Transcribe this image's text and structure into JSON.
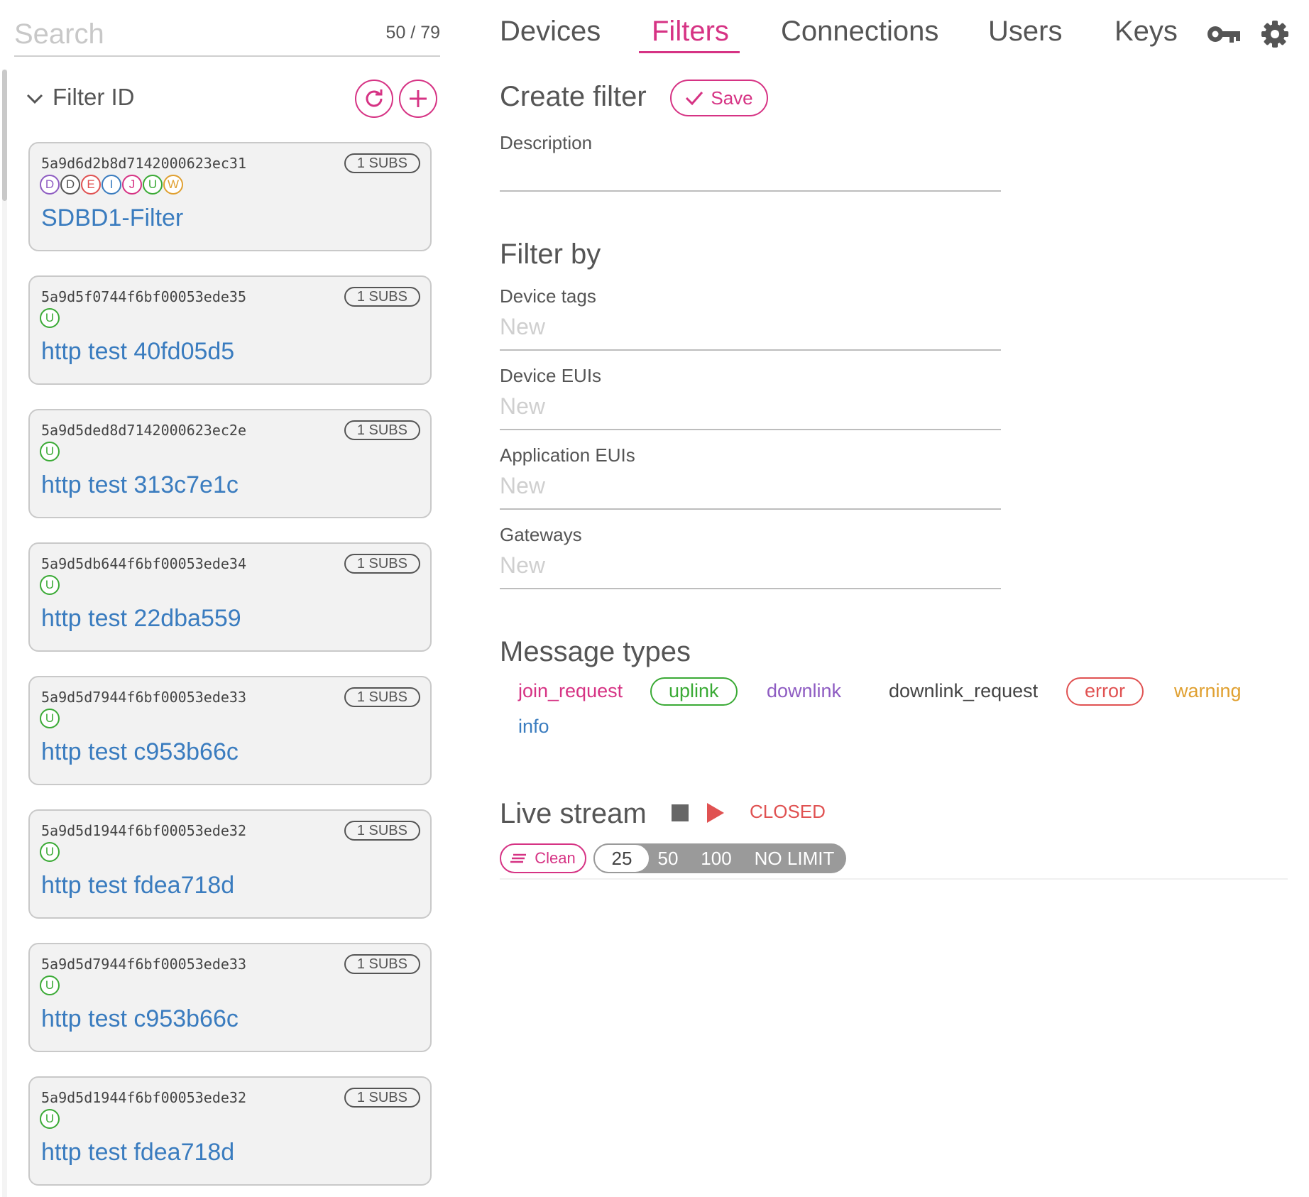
{
  "search": {
    "placeholder": "Search",
    "value": "",
    "count": "50 / 79"
  },
  "sidebar": {
    "header_title": "Filter ID",
    "filters": [
      {
        "id": "5a9d6d2b8d7142000623ec31",
        "subs": "1 SUBS",
        "tags": [
          "D",
          "D",
          "E",
          "I",
          "J",
          "U",
          "W"
        ],
        "name": "SDBD1-Filter"
      },
      {
        "id": "5a9d5f0744f6bf00053ede35",
        "subs": "1 SUBS",
        "tags": [
          "U"
        ],
        "name": "http test 40fd05d5"
      },
      {
        "id": "5a9d5ded8d7142000623ec2e",
        "subs": "1 SUBS",
        "tags": [
          "U"
        ],
        "name": "http test 313c7e1c"
      },
      {
        "id": "5a9d5db644f6bf00053ede34",
        "subs": "1 SUBS",
        "tags": [
          "U"
        ],
        "name": "http test 22dba559"
      },
      {
        "id": "5a9d5d7944f6bf00053ede33",
        "subs": "1 SUBS",
        "tags": [
          "U"
        ],
        "name": "http test c953b66c"
      },
      {
        "id": "5a9d5d1944f6bf00053ede32",
        "subs": "1 SUBS",
        "tags": [
          "U"
        ],
        "name": "http test fdea718d"
      },
      {
        "id": "5a9d5d7944f6bf00053ede33",
        "subs": "1 SUBS",
        "tags": [
          "U"
        ],
        "name": "http test c953b66c"
      },
      {
        "id": "5a9d5d1944f6bf00053ede32",
        "subs": "1 SUBS",
        "tags": [
          "U"
        ],
        "name": "http test fdea718d"
      }
    ],
    "tag_colors": {
      "D": "#8e5cc2",
      "D2": "#555555",
      "E": "#e05252",
      "I": "#3a7cbf",
      "J": "#d63384",
      "U": "#3aaa35",
      "W": "#e0a030"
    }
  },
  "nav": {
    "tabs": [
      "Devices",
      "Filters",
      "Connections",
      "Users",
      "Keys"
    ],
    "active": "Filters",
    "icons": [
      "key-icon",
      "gear-icon"
    ]
  },
  "create": {
    "title": "Create filter",
    "save_label": "Save",
    "description_label": "Description",
    "description_value": ""
  },
  "filter_by": {
    "title": "Filter by",
    "fields": [
      {
        "label": "Device tags",
        "placeholder": "New"
      },
      {
        "label": "Device EUIs",
        "placeholder": "New"
      },
      {
        "label": "Application EUIs",
        "placeholder": "New"
      },
      {
        "label": "Gateways",
        "placeholder": "New"
      }
    ]
  },
  "message_types": {
    "title": "Message types",
    "items": [
      {
        "label": "join_request",
        "color": "#d63384",
        "selected": false
      },
      {
        "label": "uplink",
        "color": "#3aaa35",
        "selected": true
      },
      {
        "label": "downlink",
        "color": "#8e5cc2",
        "selected": false
      },
      {
        "label": "downlink_request",
        "color": "#444444",
        "selected": false
      },
      {
        "label": "error",
        "color": "#e05252",
        "selected": true
      },
      {
        "label": "warning",
        "color": "#e0a030",
        "selected": false
      },
      {
        "label": "info",
        "color": "#3a7cbf",
        "selected": false
      }
    ]
  },
  "live_stream": {
    "title": "Live stream",
    "status": "CLOSED",
    "clean_label": "Clean",
    "limits": [
      "25",
      "50",
      "100",
      "NO LIMIT"
    ],
    "selected_limit": "25"
  }
}
